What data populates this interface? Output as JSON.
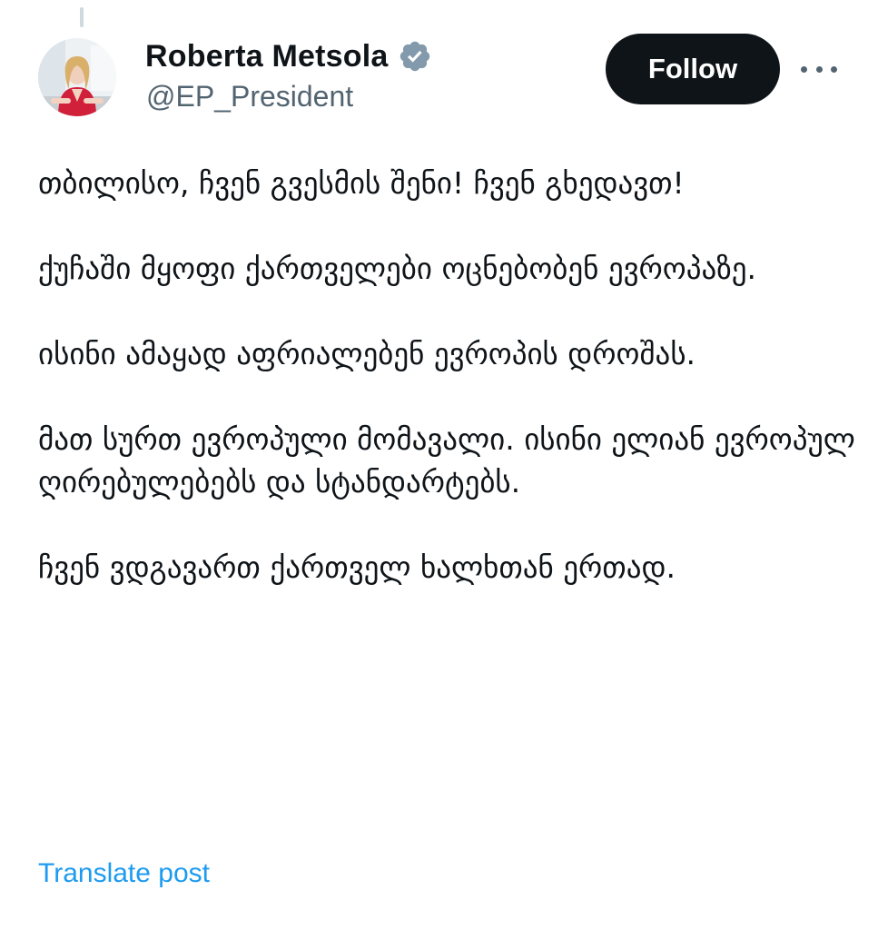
{
  "author": {
    "display_name": "Roberta Metsola",
    "handle": "@EP_President",
    "verified_badge_color": "#829aab",
    "avatar": "profile-photo"
  },
  "actions": {
    "follow_label": "Follow",
    "more_icon": "ellipsis-icon"
  },
  "post": {
    "paragraphs": [
      "თბილისო, ჩვენ გვესმის შენი! ჩვენ გხედავთ!",
      "ქუჩაში მყოფი ქართველები ოცნებობენ ევროპაზე.",
      "ისინი ამაყად აფრიალებენ ევროპის დროშას.",
      "მათ სურთ ევროპული მომავალი. ისინი ელიან ევროპულ ღირებულებებს და სტანდარტებს.",
      "ჩვენ ვდგავართ ქართველ ხალხთან ერთად."
    ],
    "translate_label": "Translate post"
  },
  "colors": {
    "text_primary": "#0f1419",
    "text_secondary": "#536471",
    "link": "#1d9bf0",
    "follow_bg": "#0f1419"
  }
}
